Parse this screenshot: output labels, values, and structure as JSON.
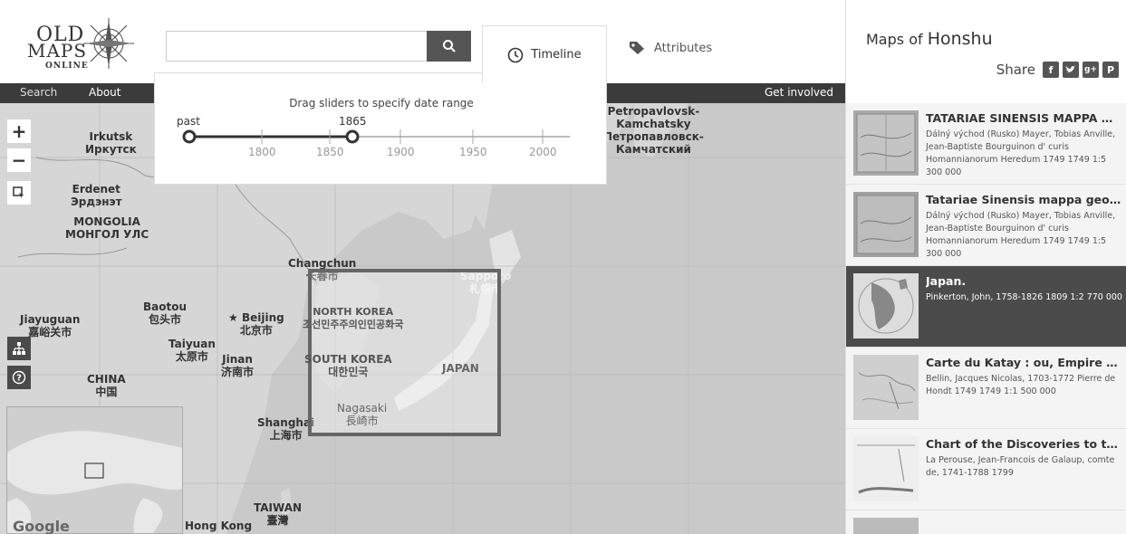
{
  "app": {
    "logo": {
      "line1": "OLD",
      "line2": "MAPS",
      "line3": "ONLINE"
    }
  },
  "search": {
    "value": "",
    "placeholder": ""
  },
  "tabs": [
    {
      "label": "Timeline",
      "icon": "clock-icon",
      "active": true
    },
    {
      "label": "Attributes",
      "icon": "tag-icon",
      "active": false
    }
  ],
  "nav": {
    "search": "Search",
    "about": "About",
    "get_involved": "Get involved"
  },
  "timeline": {
    "hint": "Drag sliders to specify date range",
    "start_label": "past",
    "end_value": "1865",
    "ticks": [
      "1800",
      "1850",
      "1900",
      "1950",
      "2000"
    ]
  },
  "map_controls": {
    "zoom_in": "+",
    "zoom_out": "−"
  },
  "map_labels": {
    "irkutsk": "Irkutsk",
    "irkutsk_ru": "Иркутск",
    "erdenet": "Erdenet",
    "erdenet_mn": "Эрдэнэт",
    "mongolia": "MONGOLIA",
    "mongolia_mn": "МОНГОЛ УЛС",
    "petropavlovsk": "Petropavlovsk-",
    "kamchatsky": "Kamchatsky",
    "petropavlovsk_ru": "Петропавловск-",
    "kamchatsky_ru": "Камчатский",
    "changchun": "Changchun",
    "changchun_zh": "长春市",
    "sapporo": "Sapporo",
    "sapporo_ja": "札幌市",
    "baotou": "Baotou",
    "baotou_zh": "包头市",
    "jiayuguan": "Jiayuguan",
    "jiayuguan_zh": "嘉峪关市",
    "beijing": "Beijing",
    "beijing_zh": "北京市",
    "taiyuan": "Taiyuan",
    "taiyuan_zh": "太原市",
    "jinan": "Jinan",
    "jinan_zh": "济南市",
    "north_korea": "NORTH KOREA",
    "north_korea_ko": "조선민주주의인민공화국",
    "south_korea": "SOUTH KOREA",
    "south_korea_ko": "대한민국",
    "japan": "JAPAN",
    "china": "CHINA",
    "china_zh": "中国",
    "nagasaki": "Nagasaki",
    "nagasaki_ja": "長崎市",
    "shanghai": "Shanghai",
    "shanghai_zh": "上海市",
    "taiwan": "TAIWAN",
    "taiwan_zh": "臺灣",
    "hong_kong": "Hong Kong",
    "google": "Google"
  },
  "sidebar": {
    "title_prefix": "Maps of",
    "title_place": "Honshu",
    "share_label": "Share",
    "social_icons": [
      "facebook-icon",
      "twitter-icon",
      "googleplus-icon",
      "pinterest-icon"
    ],
    "results": [
      {
        "title": "TATARIAE SINENSIS MAPPA GE...",
        "meta": "Dálný východ (Rusko) Mayer, Tobias Anville, Jean-Baptiste Bourguinon d' curis Homannianorum Heredum 1749 1749 1:5 300 000",
        "active": false
      },
      {
        "title": "Tatariae Sinensis mappa geogr...",
        "meta": "Dálný východ (Rusko) Mayer, Tobias Anville, Jean-Baptiste Bourguinon d' curis Homannianorum Heredum 1749 1749 1:5 300 000",
        "active": false
      },
      {
        "title": "Japan.",
        "meta": "Pinkerton, John, 1758-1826 1809 1:2 770 000",
        "active": true
      },
      {
        "title": "Carte du Katay : ou, Empire de ...",
        "meta": "Bellin, Jacques Nicolas, 1703-1772 Pierre de Hondt 1749 1749 1:1 500 000",
        "active": false
      },
      {
        "title": "Chart of the Discoveries to the ...",
        "meta": "La Perouse, Jean-Francois de Galaup, comte de, 1741-1788 1799",
        "active": false
      }
    ]
  },
  "colors": {
    "nav_bg": "#3b3b3b",
    "active_item_bg": "#4b4b4b",
    "search_button": "#555555",
    "map_water": "#c9c9c9",
    "map_land": "#d6d6d6"
  }
}
